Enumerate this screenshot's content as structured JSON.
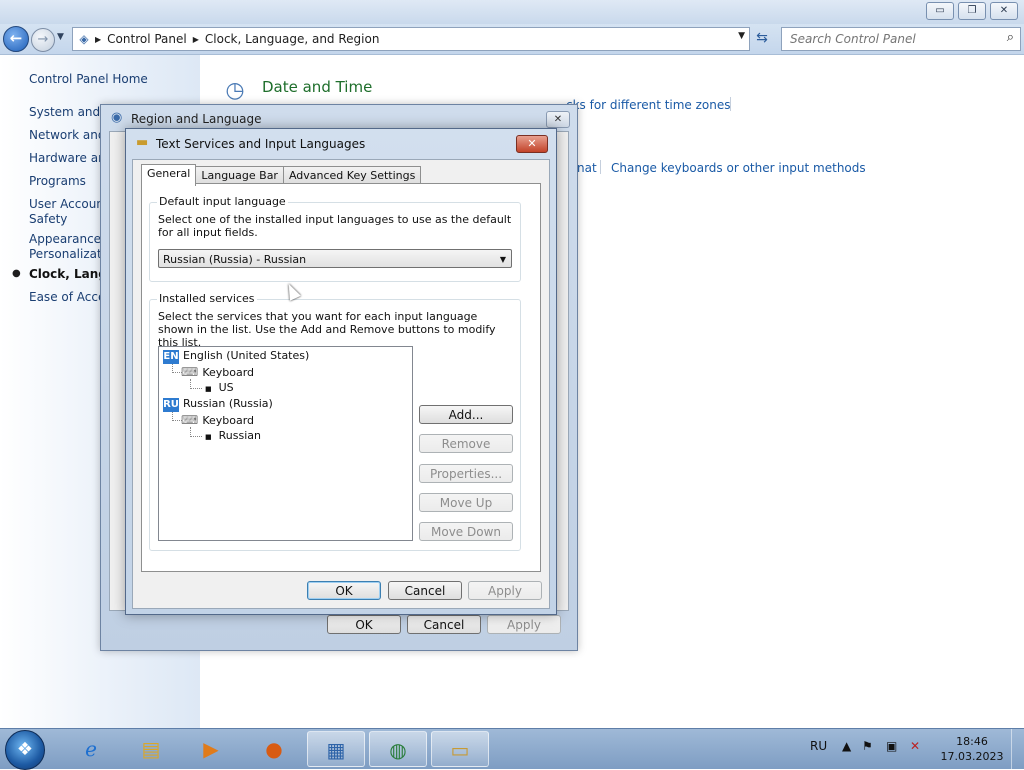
{
  "window": {
    "minimize": "▭",
    "maximize": "❐",
    "close": "✕"
  },
  "address": {
    "crumbs": [
      "Control Panel",
      "Clock, Language, and Region"
    ],
    "search_placeholder": "Search Control Panel"
  },
  "left_nav": {
    "home": "Control Panel Home",
    "items": [
      "System and S",
      "Network and",
      "Hardware and",
      "Programs",
      "User Account",
      "Safety",
      "Appearance a",
      "Personalizatio",
      "Clock, Langua",
      "Ease of Acces"
    ]
  },
  "main": {
    "category_title": "Date and Time",
    "link_time_zones": "cks for different time zones",
    "link_format": "nat",
    "link_keyboards": "Change keyboards or other input methods"
  },
  "region_dialog": {
    "title": "Region and Language",
    "close": "✕",
    "ok": "OK",
    "cancel": "Cancel",
    "apply": "Apply"
  },
  "text_services_dialog": {
    "title": "Text Services and Input Languages",
    "close": "✕",
    "tabs": [
      "General",
      "Language Bar",
      "Advanced Key Settings"
    ],
    "default_group": {
      "title": "Default input language",
      "description": "Select one of the installed input languages to use as the default for all input fields.",
      "selected": "Russian (Russia) - Russian"
    },
    "services_group": {
      "title": "Installed services",
      "description": "Select the services that you want for each input language shown in the list. Use the Add and Remove buttons to modify this list.",
      "tree": [
        {
          "code": "EN",
          "language": "English (United States)",
          "category": "Keyboard",
          "layout": "US"
        },
        {
          "code": "RU",
          "language": "Russian (Russia)",
          "category": "Keyboard",
          "layout": "Russian"
        }
      ],
      "buttons": {
        "add": "Add...",
        "remove": "Remove",
        "properties": "Properties...",
        "move_up": "Move Up",
        "move_down": "Move Down"
      }
    },
    "ok": "OK",
    "cancel": "Cancel",
    "apply": "Apply"
  },
  "taskbar": {
    "language": "RU",
    "time": "18:46",
    "date": "17.03.2023"
  }
}
